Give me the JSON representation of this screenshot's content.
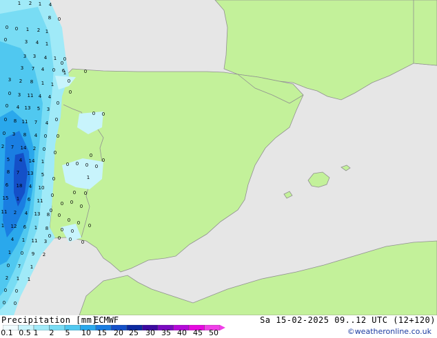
{
  "map": {
    "title": "Precipitation [mm]",
    "model": "ECMWF",
    "datetime": "Sa 15-02-2025 09..12 UTC (12+120)",
    "credit": "©weatheronline.co.uk",
    "colors": {
      "land": "#c3f19a",
      "sea": "#e6e6e6",
      "border": "#909090"
    },
    "legend": {
      "labels": [
        "0.1",
        "0.5",
        "1",
        "2",
        "5",
        "10",
        "15",
        "20",
        "25",
        "30",
        "35",
        "40",
        "45",
        "50"
      ],
      "colors": [
        "#f0fcff",
        "#c8f4fc",
        "#a0eaf8",
        "#78dcf4",
        "#50c8f0",
        "#2aa8ec",
        "#1a7ee2",
        "#1450c8",
        "#0c2aa0",
        "#3c0aa0",
        "#7a0ac0",
        "#b40ad8",
        "#e60ae0",
        "#f040e8"
      ]
    },
    "station_values": [
      "1",
      "2",
      "1",
      "4",
      "0",
      "0",
      "1",
      "2",
      "8",
      "0",
      "1",
      "3",
      "4",
      "1",
      "0",
      "3",
      "3",
      "4",
      "1",
      "0",
      "3",
      "7",
      "4",
      "0",
      "6",
      "3",
      "2",
      "8",
      "1",
      "1",
      "0",
      "3",
      "11",
      "4",
      "4",
      "0",
      "4",
      "13",
      "5",
      "3",
      "0",
      "8",
      "11",
      "7",
      "4",
      "0",
      "3",
      "8",
      "4",
      "0",
      "2",
      "7",
      "14",
      "2",
      "0",
      "5",
      "4",
      "14",
      "1",
      "8",
      "7",
      "13",
      "5",
      "6",
      "18",
      "4",
      "10",
      "15",
      "1",
      "6",
      "11",
      "11",
      "2",
      "4",
      "13",
      "8",
      "1",
      "12",
      "6",
      "1",
      "8",
      "4",
      "1",
      "11",
      "3",
      "1",
      "0",
      "9",
      "2",
      "0",
      "7",
      "1",
      "2",
      "1",
      "1",
      "0",
      "0",
      "0",
      "0",
      "0",
      "0",
      "0",
      "0",
      "0",
      "0",
      "0",
      "0",
      "0",
      "1",
      "0",
      "0",
      "0",
      "0",
      "0",
      "0",
      "0",
      "0",
      "0",
      "0",
      "0",
      "0",
      "0",
      "0",
      "0",
      "0",
      "1",
      "0",
      "0",
      "0",
      "0",
      "0",
      "0",
      "0",
      "0",
      "0"
    ]
  }
}
